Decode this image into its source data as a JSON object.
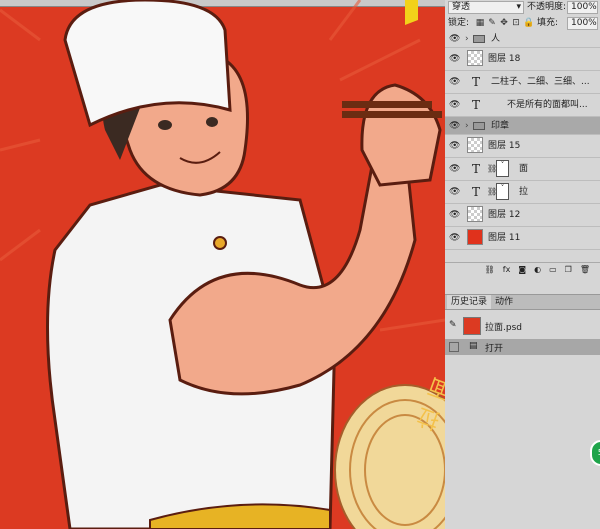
{
  "canvas": {
    "stamp_text": "拉面"
  },
  "top_bar": {
    "blend_mode": "穿透",
    "opacity_label": "不透明度:",
    "opacity_value": "100%",
    "lock_label": "锁定:",
    "fill_label": "填充:",
    "fill_value": "100%"
  },
  "layers": [
    {
      "type": "group",
      "name": "人"
    },
    {
      "type": "raster",
      "name": "图层 18"
    },
    {
      "type": "text",
      "name": "二柱子、二细、三细、..."
    },
    {
      "type": "text",
      "name": "不是所有的面都叫..."
    },
    {
      "type": "group",
      "name": "印章",
      "selected": true
    },
    {
      "type": "raster",
      "name": "图层 15"
    },
    {
      "type": "text_masked",
      "name": "面"
    },
    {
      "type": "text_masked",
      "name": "拉"
    },
    {
      "type": "raster",
      "name": "图层 12"
    },
    {
      "type": "fill",
      "name": "图层 11",
      "color": "#e0321c"
    }
  ],
  "layer_footer_icons": [
    "link-icon",
    "fx-icon",
    "mask-icon",
    "adjustment-icon",
    "folder-icon",
    "new-layer-icon",
    "trash-icon"
  ],
  "history_panel": {
    "tabs": [
      "历史记录",
      "动作"
    ],
    "snapshot": "拉面.psd",
    "items": [
      "打开"
    ]
  },
  "badge": {
    "label": "59"
  }
}
